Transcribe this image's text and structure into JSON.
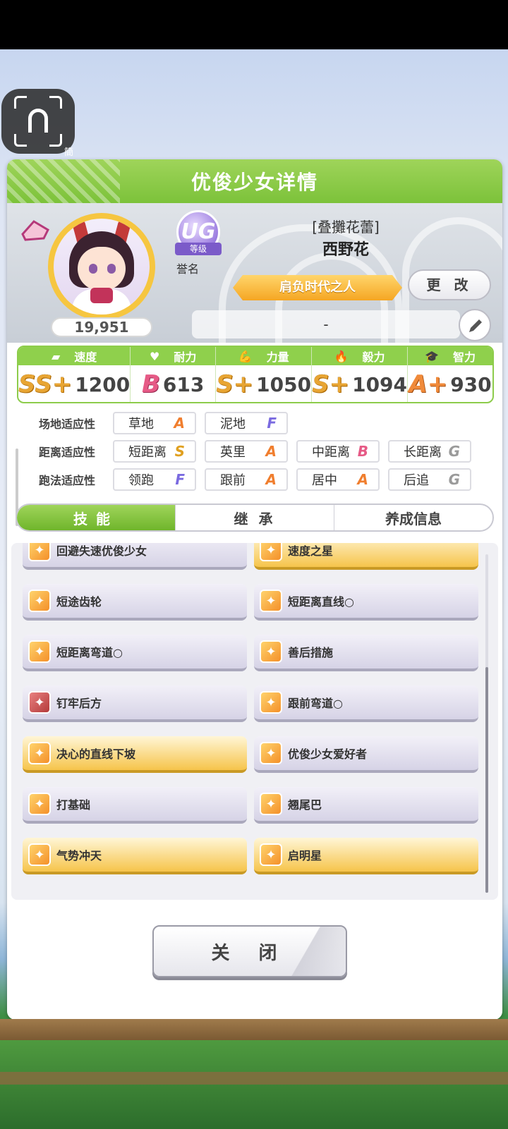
{
  "header": {
    "title": "优俊少女详情",
    "camera_label": "簡"
  },
  "profile": {
    "fans": "19,951",
    "rank_badge": "UG",
    "rank_badge_sub": "等级",
    "honor_label": "誉名",
    "costume_title": "[叠攤花蕾]",
    "name": "西野花",
    "epithet": "肩负时代之人",
    "change_label": "更 改",
    "message": "-"
  },
  "stats": [
    {
      "label": "速度",
      "icon": "shoe-icon",
      "grade": "SS+",
      "value": "1200"
    },
    {
      "label": "耐力",
      "icon": "heart-icon",
      "grade": "B",
      "value": "613"
    },
    {
      "label": "力量",
      "icon": "muscle-icon",
      "grade": "S+",
      "value": "1050"
    },
    {
      "label": "毅力",
      "icon": "flame-icon",
      "grade": "S+",
      "value": "1094"
    },
    {
      "label": "智力",
      "icon": "graduation-cap-icon",
      "grade": "A+",
      "value": "930"
    }
  ],
  "aptitude": {
    "track": {
      "label": "场地适应性",
      "items": [
        {
          "name": "草地",
          "grade": "A"
        },
        {
          "name": "泥地",
          "grade": "F"
        }
      ]
    },
    "distance": {
      "label": "距离适应性",
      "items": [
        {
          "name": "短距离",
          "grade": "S"
        },
        {
          "name": "英里",
          "grade": "A"
        },
        {
          "name": "中距离",
          "grade": "B"
        },
        {
          "name": "长距离",
          "grade": "G"
        }
      ]
    },
    "style": {
      "label": "跑法适应性",
      "items": [
        {
          "name": "领跑",
          "grade": "F"
        },
        {
          "name": "跟前",
          "grade": "A"
        },
        {
          "name": "居中",
          "grade": "A"
        },
        {
          "name": "后追",
          "grade": "G"
        }
      ]
    }
  },
  "tabs": [
    "技能",
    "继 承",
    "养成信息"
  ],
  "skills": [
    {
      "name": "回避失速优俊少女",
      "style": "normal",
      "icon": "speed-skill-icon"
    },
    {
      "name": "速度之星",
      "style": "gold",
      "icon": "speed-skill-icon"
    },
    {
      "name": "短途齿轮",
      "style": "normal",
      "icon": "speed-skill-icon"
    },
    {
      "name": "短距离直线○",
      "style": "normal",
      "icon": "speed-skill-icon"
    },
    {
      "name": "短距离弯道○",
      "style": "normal",
      "icon": "speed-skill-icon"
    },
    {
      "name": "善后措施",
      "style": "normal",
      "icon": "speed-skill-icon"
    },
    {
      "name": "钉牢后方",
      "style": "normal",
      "icon": "debuff-skill-icon"
    },
    {
      "name": "跟前弯道○",
      "style": "normal",
      "icon": "speed-skill-icon"
    },
    {
      "name": "决心的直线下坡",
      "style": "gold",
      "icon": "speed-skill-icon"
    },
    {
      "name": "优俊少女爱好者",
      "style": "normal",
      "icon": "speed-skill-icon"
    },
    {
      "name": "打基础",
      "style": "normal",
      "icon": "speed-skill-icon"
    },
    {
      "name": "翘尾巴",
      "style": "normal",
      "icon": "speed-skill-icon"
    },
    {
      "name": "气势冲天",
      "style": "gold",
      "icon": "speed-skill-icon"
    },
    {
      "name": "启明星",
      "style": "gold",
      "icon": "speed-skill-icon"
    }
  ],
  "close_label": "关 闭"
}
